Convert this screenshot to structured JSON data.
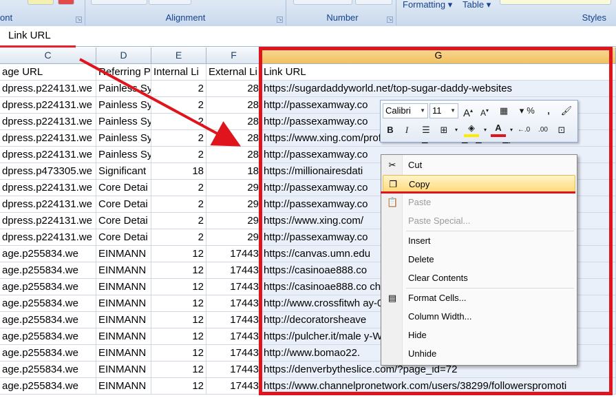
{
  "ribbon": {
    "groups": [
      "ont",
      "Alignment",
      "Number",
      "Styles"
    ],
    "formatting_label": "Formatting",
    "table_label": "Table"
  },
  "formula_bar": {
    "value": "Link URL"
  },
  "columns": [
    "C",
    "D",
    "E",
    "F",
    "G"
  ],
  "rows": [
    [
      "age URL",
      "Referring P",
      "Internal Li",
      "External Li",
      "Link URL"
    ],
    [
      "dpress.p224131.we",
      "Painless Sy",
      "2",
      "28",
      "https://sugardaddyworld.net/top-sugar-daddy-websites"
    ],
    [
      "dpress.p224131.we",
      "Painless Sy",
      "2",
      "28",
      "http://passexamway.co"
    ],
    [
      "dpress.p224131.we",
      "Painless Sy",
      "2",
      "28",
      "http://passexamway.co"
    ],
    [
      "dpress.p224131.we",
      "Painless Sy",
      "2",
      "28",
      "https://www.xing.com/profile/Judith_Victoria_O_Wirb_p"
    ],
    [
      "dpress.p224131.we",
      "Painless Sy",
      "2",
      "28",
      "http://passexamway.co"
    ],
    [
      "dpress.p473305.we",
      "Significant",
      "18",
      "18",
      "https://millionairesdati"
    ],
    [
      "dpress.p224131.we",
      "Core Detai",
      "2",
      "29",
      "http://passexamway.co"
    ],
    [
      "dpress.p224131.we",
      "Core Detai",
      "2",
      "29",
      "http://passexamway.co"
    ],
    [
      "dpress.p224131.we",
      "Core Detai",
      "2",
      "29",
      "https://www.xing.com/"
    ],
    [
      "dpress.p224131.we",
      "Core Detai",
      "2",
      "29",
      "http://passexamway.co"
    ],
    [
      "age.p255834.we",
      "EINMANN",
      "12",
      "17443",
      "https://canvas.umn.edu"
    ],
    [
      "age.p255834.we",
      "EINMANN",
      "12",
      "17443",
      "https://casinoae888.co"
    ],
    [
      "age.p255834.we",
      "EINMANN",
      "12",
      "17443",
      "https://casinoae888.co                                          chment"
    ],
    [
      "age.p255834.we",
      "EINMANN",
      "12",
      "17443",
      "http://www.crossfitwh                                             ay-0815"
    ],
    [
      "age.p255834.we",
      "EINMANN",
      "12",
      "17443",
      "http://decoratorsheave"
    ],
    [
      "age.p255834.we",
      "EINMANN",
      "12",
      "17443",
      "https://pulcher.it/male                                             y-W3N-"
    ],
    [
      "age.p255834.we",
      "EINMANN",
      "12",
      "17443",
      "http://www.bomao22."
    ],
    [
      "age.p255834.we",
      "EINMANN",
      "12",
      "17443",
      "https://denverbytheslice.com/?page_id=72"
    ],
    [
      "age.p255834.we",
      "EINMANN",
      "12",
      "17443",
      "https://www.channelpronetwork.com/users/38299/followerspromoti"
    ]
  ],
  "mini_toolbar": {
    "font": "Calibri",
    "size": "11",
    "grow_font": "A",
    "shrink_font": "A",
    "percent": "%",
    "comma": ",",
    "bold": "B",
    "italic": "I",
    "font_color": "A"
  },
  "context_menu": {
    "items": [
      "Cut",
      "Copy",
      "Paste",
      "Paste Special...",
      "Insert",
      "Delete",
      "Clear Contents",
      "Format Cells...",
      "Column Width...",
      "Hide",
      "Unhide"
    ]
  },
  "colors": {
    "highlight_red": "#e0141c",
    "selected_col": "#f1c15f"
  }
}
